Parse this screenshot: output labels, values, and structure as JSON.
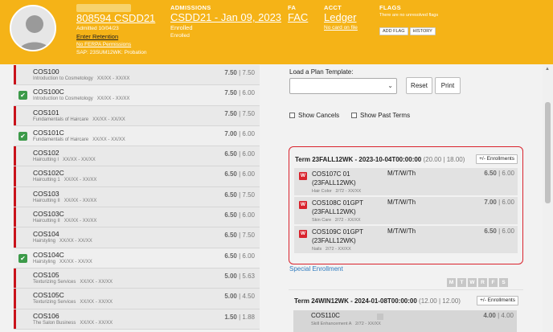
{
  "header": {
    "student_id": "808594 CSDD21",
    "admitted": "Admitted 10/04/23",
    "enter_retention": "Enter Retention",
    "ferpa": "No FERPA Permissions",
    "sap": "SAP: 23SUM12WK: Probation",
    "admissions_label": "ADMISSIONS",
    "admissions_value": "CSDD21 - Jan 09, 2023",
    "enrolled": "Enrolled",
    "enrolled_sub": "Enrolled",
    "fa_label": "FA",
    "fa_value": "FAC",
    "acct_label": "ACCT",
    "acct_value": "Ledger",
    "acct_sub": "No card on file",
    "flags_label": "FLAGS",
    "flags_sub": "There are no unresolved flags",
    "add_flag": "ADD FLAG",
    "history": "HISTORY"
  },
  "courses": [
    {
      "code": "COS100",
      "desc": "Introduction to Cosmetology",
      "dates": "XX/XX - XX/XX",
      "earned": "7.50",
      "total": "7.50",
      "checked": false
    },
    {
      "code": "COS100C",
      "desc": "Introduction to Cosmetology",
      "dates": "XX/XX - XX/XX",
      "earned": "7.50",
      "total": "6.00",
      "checked": true
    },
    {
      "code": "COS101",
      "desc": "Fundamentals of Haircare",
      "dates": "XX/XX - XX/XX",
      "earned": "7.50",
      "total": "7.50",
      "checked": false
    },
    {
      "code": "COS101C",
      "desc": "Fundamentals of Haircare",
      "dates": "XX/XX - XX/XX",
      "earned": "7.00",
      "total": "6.00",
      "checked": true
    },
    {
      "code": "COS102",
      "desc": "Haircutting I",
      "dates": "XX/XX - XX/XX",
      "earned": "6.50",
      "total": "6.00",
      "checked": false
    },
    {
      "code": "COS102C",
      "desc": "Haircutting 1",
      "dates": "XX/XX - XX/XX",
      "earned": "6.50",
      "total": "6.00",
      "checked": false
    },
    {
      "code": "COS103",
      "desc": "Haircutting II",
      "dates": "XX/XX - XX/XX",
      "earned": "6.50",
      "total": "7.50",
      "checked": false
    },
    {
      "code": "COS103C",
      "desc": "Haircutting II",
      "dates": "XX/XX - XX/XX",
      "earned": "6.50",
      "total": "6.00",
      "checked": false
    },
    {
      "code": "COS104",
      "desc": "Hairstyling",
      "dates": "XX/XX - XX/XX",
      "earned": "6.50",
      "total": "7.50",
      "checked": false
    },
    {
      "code": "COS104C",
      "desc": "Hairstyling",
      "dates": "XX/XX - XX/XX",
      "earned": "6.50",
      "total": "6.00",
      "checked": true
    },
    {
      "code": "COS105",
      "desc": "Texturizing Services",
      "dates": "XX/XX - XX/XX",
      "earned": "5.00",
      "total": "5.63",
      "checked": false
    },
    {
      "code": "COS105C",
      "desc": "Texturizing Services",
      "dates": "XX/XX - XX/XX",
      "earned": "5.00",
      "total": "4.50",
      "checked": false
    },
    {
      "code": "COS106",
      "desc": "The Salon Business",
      "dates": "XX/XX - XX/XX",
      "earned": "1.50",
      "total": "1.88",
      "checked": false
    }
  ],
  "plan": {
    "label": "Load a Plan Template:",
    "reset": "Reset",
    "print": "Print",
    "show_cancels": "Show Cancels",
    "show_past_terms": "Show Past Terms"
  },
  "term1": {
    "title": "Term 23FALL12WK - 2023-10-04T00:00:00",
    "units": "(20.00 | 18.00)",
    "enroll_btn": "+/- Enrollments",
    "rows": [
      {
        "w": "W",
        "line1": "COS107C 01",
        "line2": "(23FALL12WK)",
        "sub": "Hair Color",
        "dates": "2/72 - XX/XX",
        "days": "M/T/W/Th",
        "earned": "6.50",
        "total": "6.00"
      },
      {
        "w": "W",
        "line1": "COS108C 01GPT",
        "line2": "(23FALL12WK)",
        "sub": "Skin Care",
        "dates": "2/72 - XX/XX",
        "days": "M/T/W/Th",
        "earned": "7.00",
        "total": "6.00"
      },
      {
        "w": "W",
        "line1": "COS109C 01GPT",
        "line2": "(23FALL12WK)",
        "sub": "Nails",
        "dates": "2/72 - XX/XX",
        "days": "M/T/W/Th",
        "earned": "6.50",
        "total": "6.00"
      }
    ]
  },
  "special_enrollment": "Special Enrollment",
  "weekdays": [
    "M",
    "T",
    "W",
    "R",
    "F",
    "S"
  ],
  "term2": {
    "title": "Term 24WIN12WK - 2024-01-08T00:00:00",
    "units": "(12.00 | 12.00)",
    "enroll_btn": "+/- Enrollments",
    "row": {
      "code": "COS110C",
      "sub": "Skill Enhancement A",
      "dates": "2/72 - XX/XX",
      "earned": "4.00",
      "total": "4.00"
    }
  }
}
